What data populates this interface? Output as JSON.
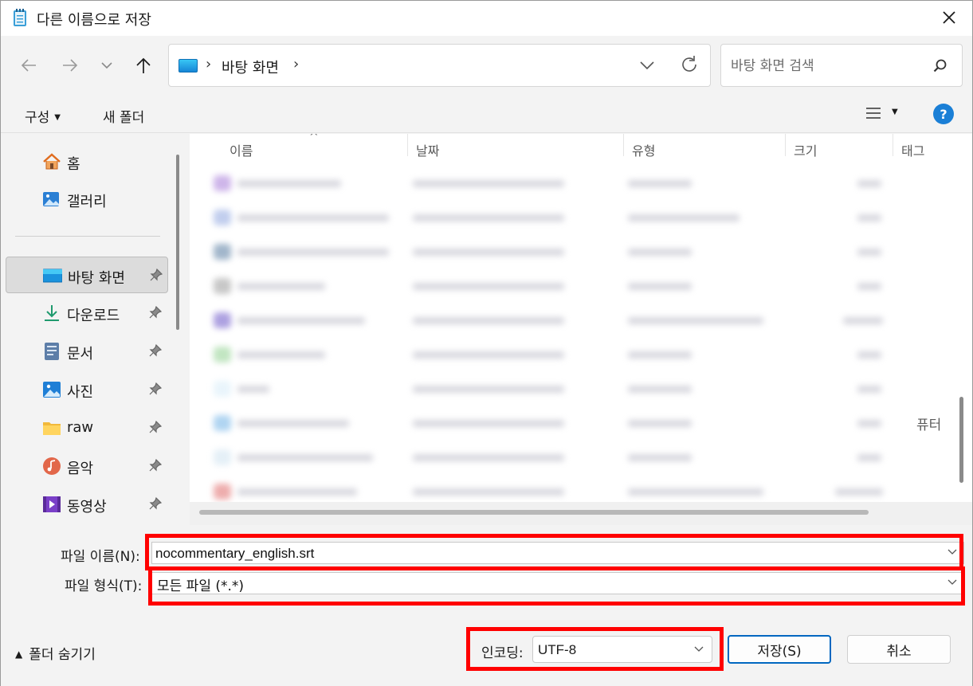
{
  "window": {
    "title": "다른 이름으로 저장"
  },
  "nav": {
    "location": "바탕 화면"
  },
  "search": {
    "placeholder": "바탕 화면 검색"
  },
  "toolbar": {
    "organize_label": "구성",
    "new_folder_label": "새 폴더",
    "help_label": "?"
  },
  "sidebar": {
    "items": [
      {
        "label": "홈",
        "icon": "home-icon",
        "pinned": false
      },
      {
        "label": "갤러리",
        "icon": "gallery-icon",
        "pinned": false
      },
      {
        "label": "바탕 화면",
        "icon": "desktop-icon",
        "pinned": true,
        "selected": true
      },
      {
        "label": "다운로드",
        "icon": "download-icon",
        "pinned": true
      },
      {
        "label": "문서",
        "icon": "document-icon",
        "pinned": true
      },
      {
        "label": "사진",
        "icon": "picture-icon",
        "pinned": true
      },
      {
        "label": "raw",
        "icon": "folder-icon",
        "pinned": true
      },
      {
        "label": "음악",
        "icon": "music-icon",
        "pinned": true
      },
      {
        "label": "동영상",
        "icon": "video-icon",
        "pinned": true
      }
    ]
  },
  "file_list": {
    "columns": [
      "이름",
      "날짜",
      "유형",
      "크기",
      "태그"
    ],
    "clipped_text": "퓨터"
  },
  "form": {
    "filename_label": "파일 이름(N):",
    "filename_value": "nocommentary_english.srt",
    "filetype_label": "파일 형식(T):",
    "filetype_value": "모든 파일  (*.*)",
    "hide_folders_label": "폴더 숨기기",
    "encoding_label": "인코딩:",
    "encoding_value": "UTF-8",
    "save_label": "저장(S)",
    "cancel_label": "취소"
  },
  "colors": {
    "highlight": "#ff0000",
    "accent": "#0067c0"
  }
}
